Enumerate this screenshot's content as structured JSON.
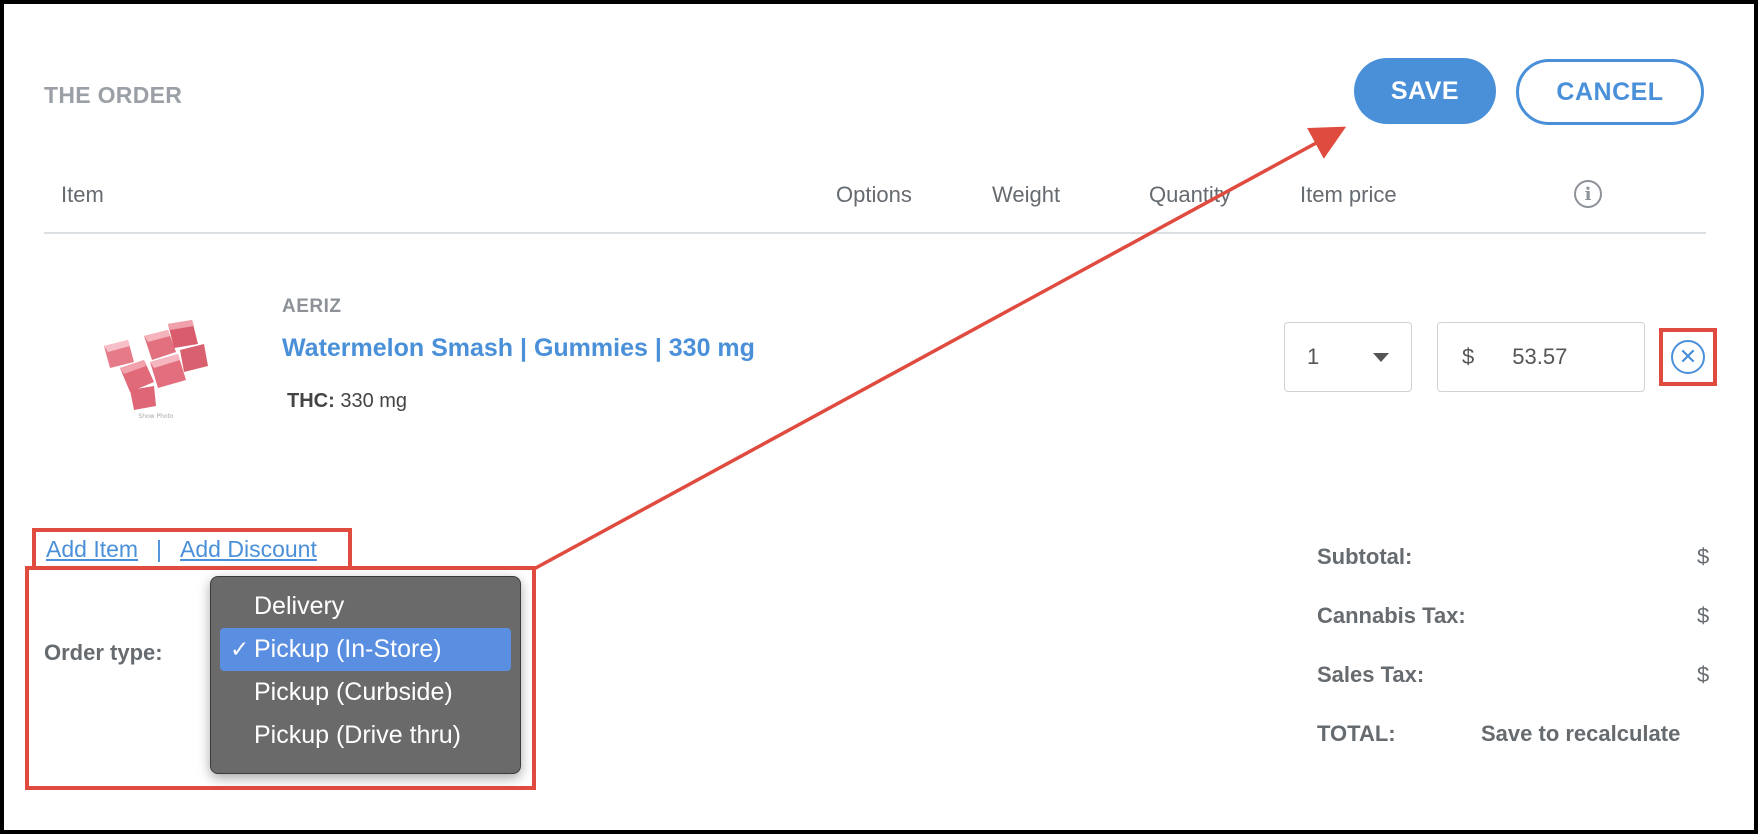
{
  "header": {
    "title": "THE ORDER",
    "save_label": "SAVE",
    "cancel_label": "CANCEL"
  },
  "columns": {
    "item": "Item",
    "options": "Options",
    "weight": "Weight",
    "quantity": "Quantity",
    "item_price": "Item price"
  },
  "product": {
    "brand": "AERIZ",
    "name": "Watermelon Smash | Gummies | 330 mg",
    "thc_label": "THC:",
    "thc_value": "330 mg",
    "image_caption": "Show Photo",
    "quantity": "1",
    "currency": "$",
    "price": "53.57"
  },
  "actions": {
    "add_item": "Add Item",
    "separator": "|",
    "add_discount": "Add Discount"
  },
  "order_type": {
    "label": "Order type:",
    "check_mark": "✓",
    "options": [
      "Delivery",
      "Pickup (In-Store)",
      "Pickup (Curbside)",
      "Pickup (Drive thru)"
    ],
    "selected": "Pickup (In-Store)"
  },
  "summary": {
    "subtotal_label": "Subtotal:",
    "subtotal_value": "$",
    "cannabis_tax_label": "Cannabis Tax:",
    "cannabis_tax_value": "$",
    "sales_tax_label": "Sales Tax:",
    "sales_tax_value": "$",
    "total_label": "TOTAL:",
    "total_value": "Save to recalculate"
  },
  "colors": {
    "accent": "#4a90d9",
    "annotation": "#e04b3f",
    "selected_option": "#5a8ee0"
  },
  "icons": {
    "info": "info-icon",
    "remove": "close-circle-icon",
    "caret": "chevron-down-icon",
    "arrow": "annotation-arrow"
  }
}
